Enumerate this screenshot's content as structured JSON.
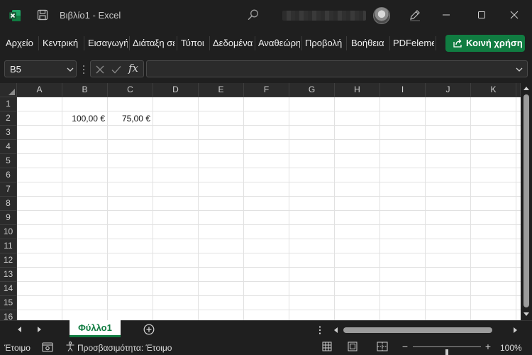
{
  "window": {
    "title": "Βιβλίο1  -  Excel",
    "accent_color": "#107c41"
  },
  "icons": {
    "app": "excel-logo-icon",
    "save": "save-icon",
    "search": "search-icon",
    "pen": "pen-icon",
    "minimize": "minimize-icon",
    "maximize": "maximize-icon",
    "close": "close-icon"
  },
  "menu": {
    "items": [
      "Αρχείο",
      "Κεντρική",
      "Εισαγωγή",
      "Διάταξη σελίδας",
      "Τύποι",
      "Δεδομένα",
      "Αναθεώρηση",
      "Προβολή",
      "Βοήθεια",
      "PDFelement"
    ],
    "share_label": "Κοινή χρήση"
  },
  "formula_bar": {
    "name_box": "B5",
    "fx_label": "fx",
    "value": ""
  },
  "grid": {
    "columns": [
      "A",
      "B",
      "C",
      "D",
      "E",
      "F",
      "G",
      "H",
      "I",
      "J",
      "K"
    ],
    "rows": [
      "1",
      "2",
      "3",
      "4",
      "5",
      "6",
      "7",
      "8",
      "9",
      "10",
      "11",
      "12",
      "13",
      "14",
      "15",
      "16"
    ],
    "cells": {
      "B2": "100,00 €",
      "C2": "75,00 €"
    },
    "selected_cell": "B5"
  },
  "sheets": {
    "tabs": [
      "Φύλλο1"
    ],
    "active": "Φύλλο1"
  },
  "status": {
    "ready": "Έτοιμο",
    "accessibility": "Προσβασιμότητα: Έτοιμο",
    "zoom": "100%",
    "zoom_level": 0.5
  }
}
